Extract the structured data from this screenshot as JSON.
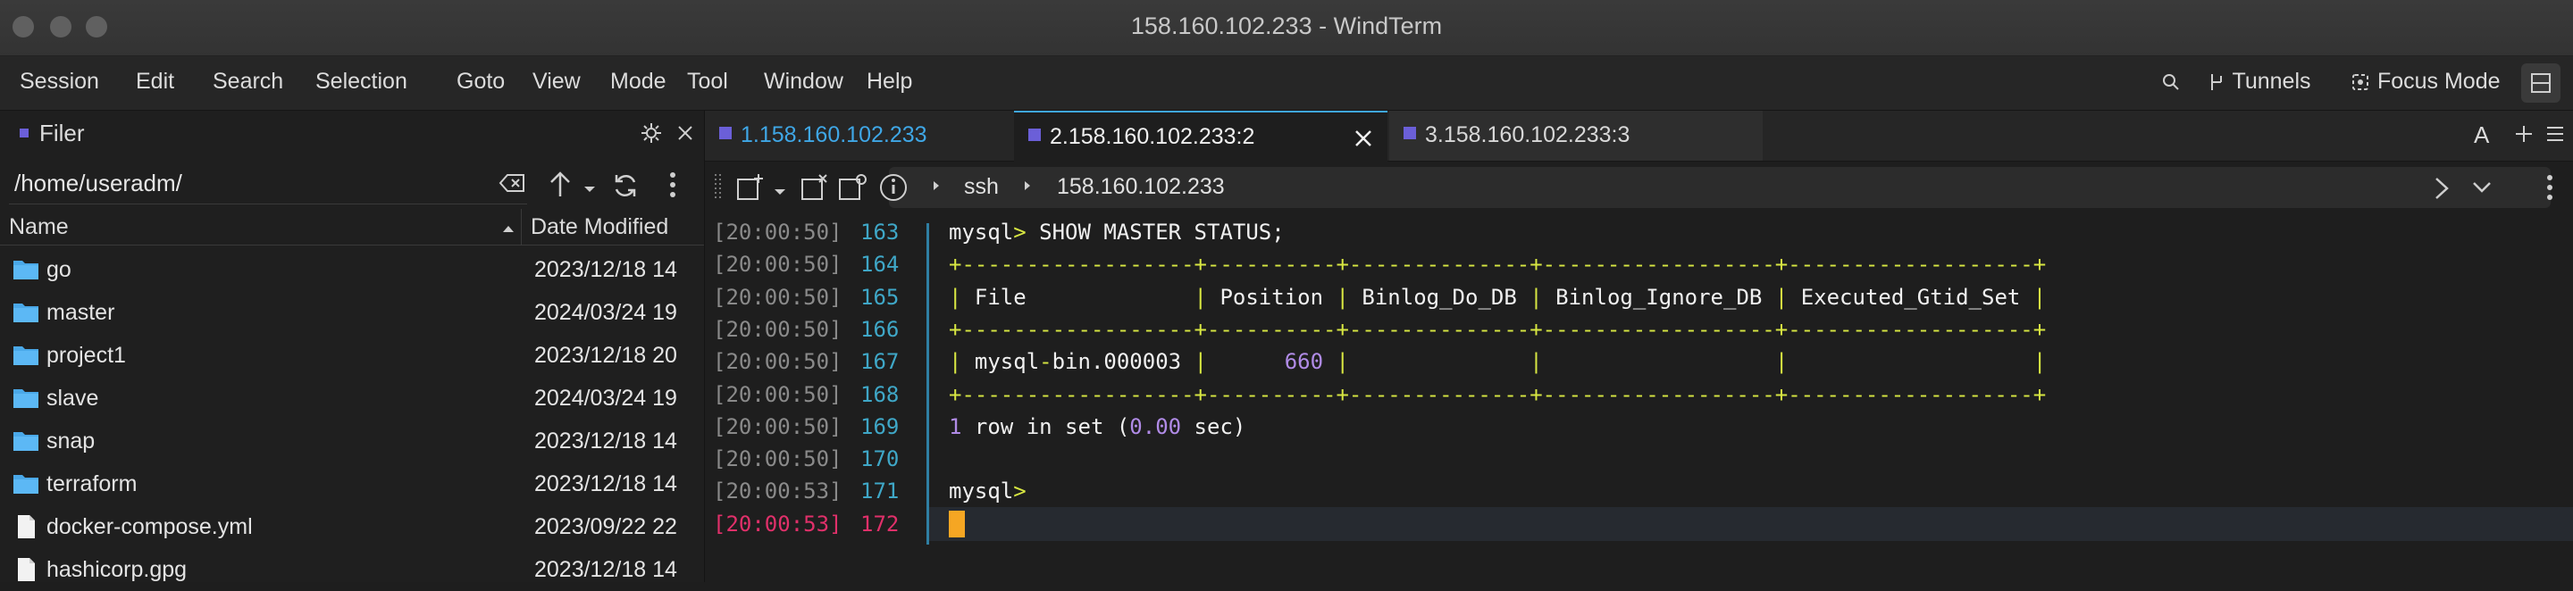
{
  "window": {
    "title": "158.160.102.233 - WindTerm"
  },
  "menu": [
    "Session",
    "Edit",
    "Search",
    "Selection",
    "Goto",
    "View",
    "Mode",
    "Tool",
    "Window",
    "Help"
  ],
  "toolbar_right": {
    "tunnels": "Tunnels",
    "focus_mode": "Focus Mode"
  },
  "filer": {
    "title": "Filer",
    "path": "/home/useradm/",
    "columns": {
      "name": "Name",
      "date": "Date Modified"
    },
    "rows": [
      {
        "name": "go",
        "date": "2023/12/18 14",
        "type": "folder"
      },
      {
        "name": "master",
        "date": "2024/03/24 19",
        "type": "folder"
      },
      {
        "name": "project1",
        "date": "2023/12/18 20",
        "type": "folder"
      },
      {
        "name": "slave",
        "date": "2024/03/24 19",
        "type": "folder"
      },
      {
        "name": "snap",
        "date": "2023/12/18 14",
        "type": "folder"
      },
      {
        "name": "terraform",
        "date": "2023/12/18 14",
        "type": "folder"
      },
      {
        "name": "docker-compose.yml",
        "date": "2023/09/22 22",
        "type": "file"
      },
      {
        "name": "hashicorp.gpg",
        "date": "2023/12/18 14",
        "type": "file"
      }
    ]
  },
  "tabs": [
    {
      "label": "1.158.160.102.233",
      "active": false
    },
    {
      "label": "2.158.160.102.233:2",
      "active": true
    },
    {
      "label": "3.158.160.102.233:3",
      "active": false
    }
  ],
  "tab_right": {
    "font_label": "A"
  },
  "breadcrumb": {
    "item1": "ssh",
    "item2": "158.160.102.233"
  },
  "terminal": {
    "lines": [
      {
        "ts": "[20:00:50]",
        "ln": "163",
        "text": "mysql> SHOW MASTER STATUS;"
      },
      {
        "ts": "[20:00:50]",
        "ln": "164",
        "text": "+------------------+----------+--------------+------------------+-------------------+"
      },
      {
        "ts": "[20:00:50]",
        "ln": "165",
        "text": "| File             | Position | Binlog_Do_DB | Binlog_Ignore_DB | Executed_Gtid_Set |"
      },
      {
        "ts": "[20:00:50]",
        "ln": "166",
        "text": "+------------------+----------+--------------+------------------+-------------------+"
      },
      {
        "ts": "[20:00:50]",
        "ln": "167",
        "text": "| mysql-bin.000003 |      660 |              |                  |                   |"
      },
      {
        "ts": "[20:00:50]",
        "ln": "168",
        "text": "+------------------+----------+--------------+------------------+-------------------+"
      },
      {
        "ts": "[20:00:50]",
        "ln": "169",
        "text": "1 row in set (0.00 sec)"
      },
      {
        "ts": "[20:00:50]",
        "ln": "170",
        "text": ""
      },
      {
        "ts": "[20:00:53]",
        "ln": "171",
        "text": "mysql>"
      },
      {
        "ts": "[20:00:53]",
        "ln": "172",
        "text": ""
      }
    ]
  },
  "colors": {
    "accent_tab_square": "#6b5fd8",
    "line_number": "#3fa7c7",
    "active_timestamp": "#e0306a",
    "table_border": "#d7e642",
    "number": "#b08be6",
    "cursor": "#f5a623"
  }
}
